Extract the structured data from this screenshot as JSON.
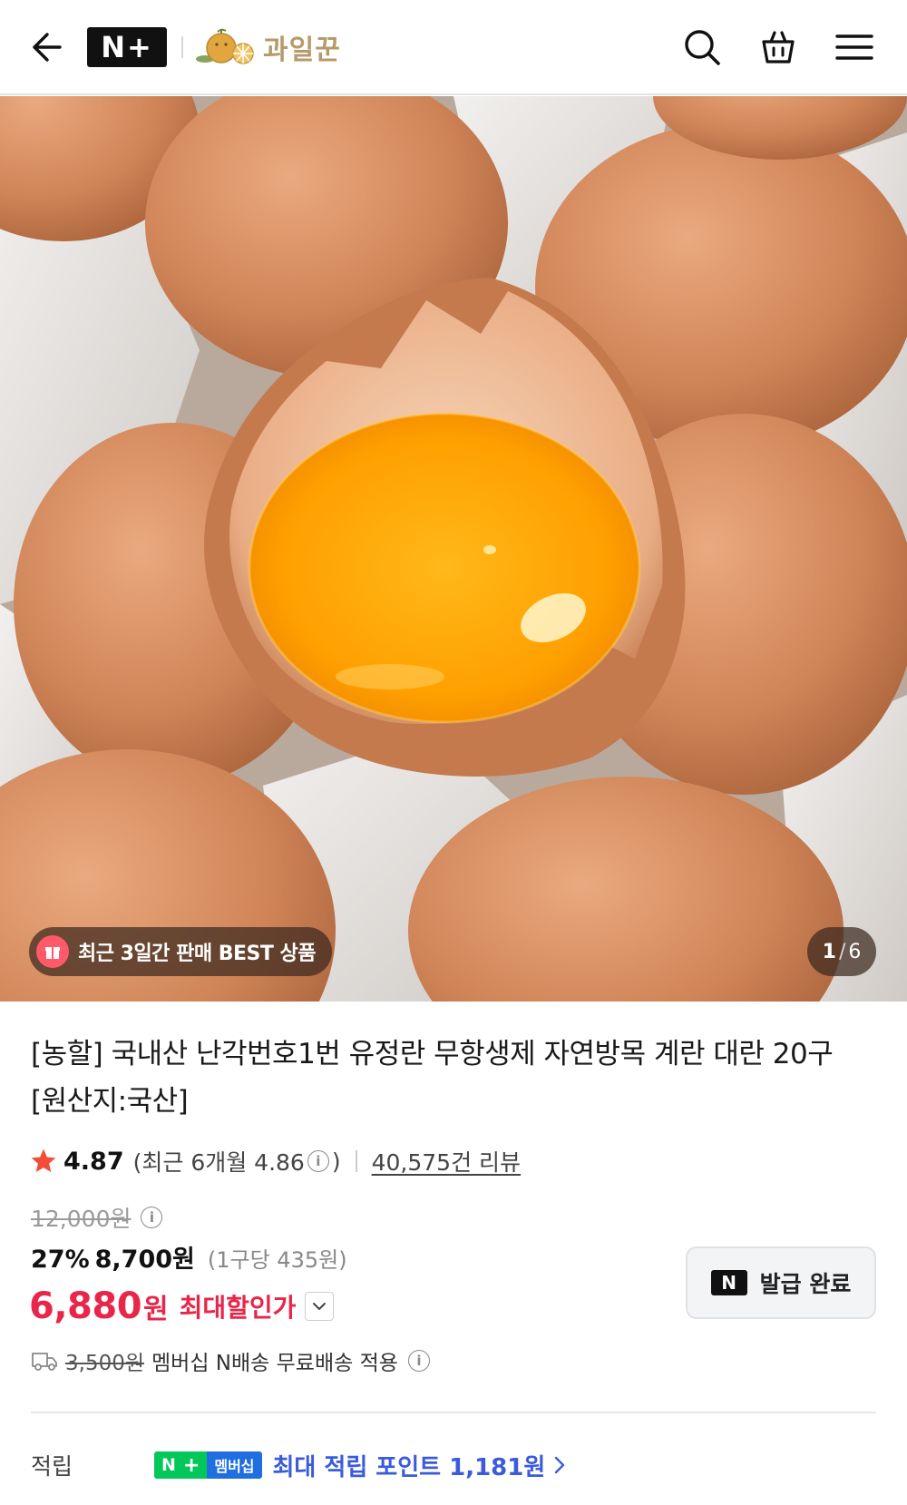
{
  "header": {
    "back_icon": "arrow-left-icon",
    "nplus_logo": "N+",
    "store_name": "과일꾼",
    "search_icon": "search-icon",
    "cart_icon": "shopping-bag-icon",
    "menu_icon": "hamburger-menu-icon"
  },
  "hero": {
    "badge_text": "최근 3일간 판매 BEST 상품",
    "pager_current": "1",
    "pager_separator": "/",
    "pager_total": "6"
  },
  "product": {
    "title": "[농할] 국내산 난각번호1번 유정란 무항생제 자연방목 계란 대란 20구 [원산지:국산]",
    "rating": "4.87",
    "recent_rating_text": "(최근 6개월 4.86",
    "recent_rating_close": ")",
    "review_count": "40,575건 리뷰",
    "original_price": "12,000원",
    "discount_pct": "27%",
    "sale_price": "8,700원",
    "unit_price": "(1구당 435원)",
    "max_discount_price": "6,880",
    "max_discount_won": "원",
    "max_discount_label": "최대할인가",
    "coupon_icon": "N",
    "coupon_button": "발급 완료",
    "shipping_original": "3,500원",
    "shipping_text": "멤버십 N배송 무료배송 적용",
    "points_label": "적립",
    "membership_n": "N",
    "membership_plus": "+",
    "membership_label": "멤버십",
    "points_text": "최대 적립 포인트 1,181원"
  },
  "colors": {
    "accent_red": "#e8264a",
    "points_blue": "#3b5bdb",
    "naver_green": "#03c75a"
  }
}
